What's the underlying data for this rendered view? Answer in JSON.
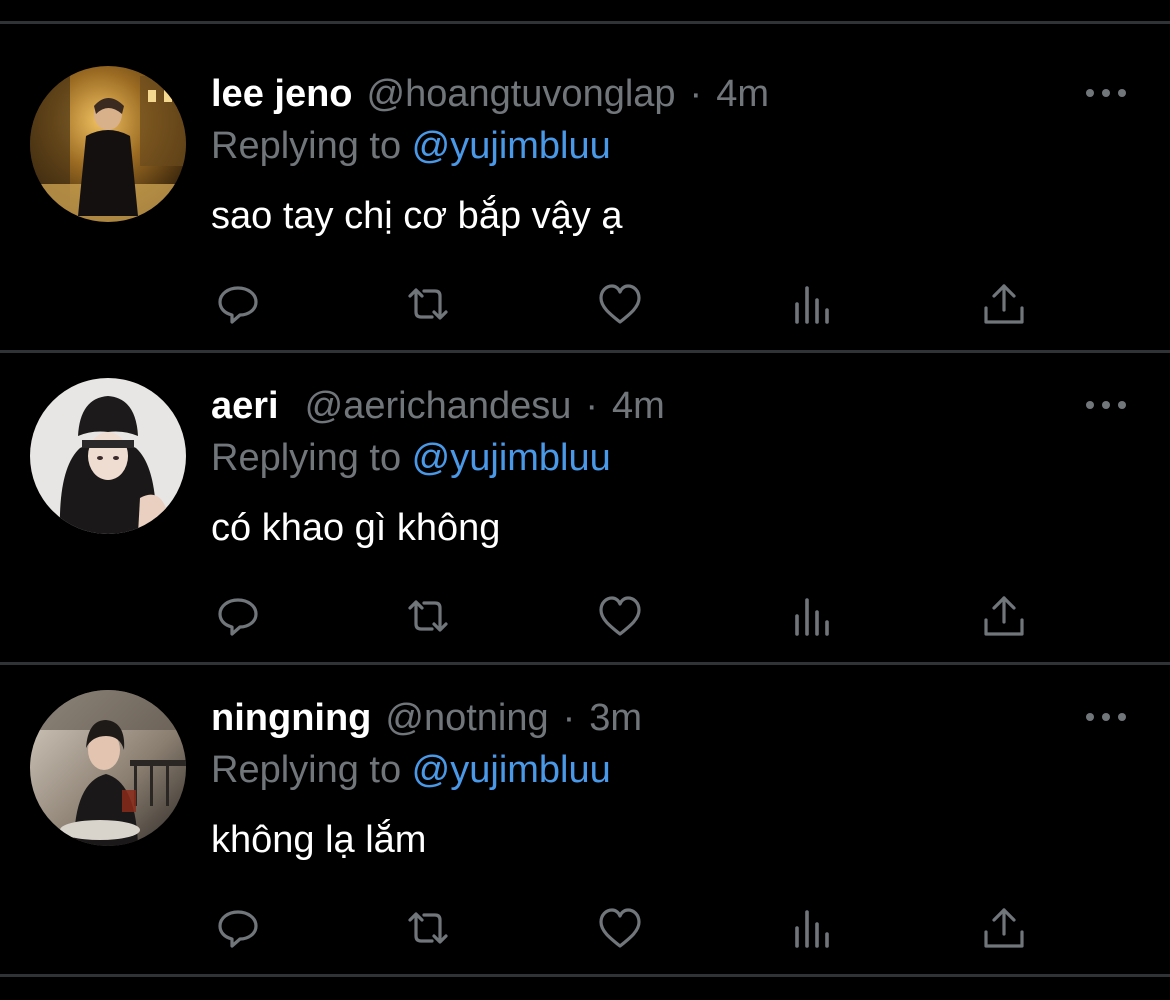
{
  "colors": {
    "background": "#000000",
    "divider": "#2f3336",
    "name": "#ffffff",
    "muted": "#71767b",
    "mention": "#4a99e9",
    "icon": "#71767b"
  },
  "action_icons": [
    "reply-icon",
    "retweet-icon",
    "like-icon",
    "analytics-icon",
    "share-icon"
  ],
  "tweets": [
    {
      "name": "lee jeno",
      "handle": "@hoangtuvonglap",
      "separator": "·",
      "time": "4m",
      "replying_prefix": "Replying to ",
      "replying_to": "@yujimbluu",
      "text": "sao tay chị cơ bắp vậy ạ",
      "avatar_icon": "night-street-photo"
    },
    {
      "name": "aeri",
      "handle": "@aerichandesu",
      "separator": "·",
      "time": "4m",
      "replying_prefix": "Replying to ",
      "replying_to": "@yujimbluu",
      "text": "có khao gì không",
      "avatar_icon": "beanie-portrait-photo"
    },
    {
      "name": "ningning",
      "handle": "@notning",
      "separator": "·",
      "time": "3m",
      "replying_prefix": "Replying to ",
      "replying_to": "@yujimbluu",
      "text": "không lạ lắm",
      "avatar_icon": "cafe-portrait-photo"
    }
  ]
}
